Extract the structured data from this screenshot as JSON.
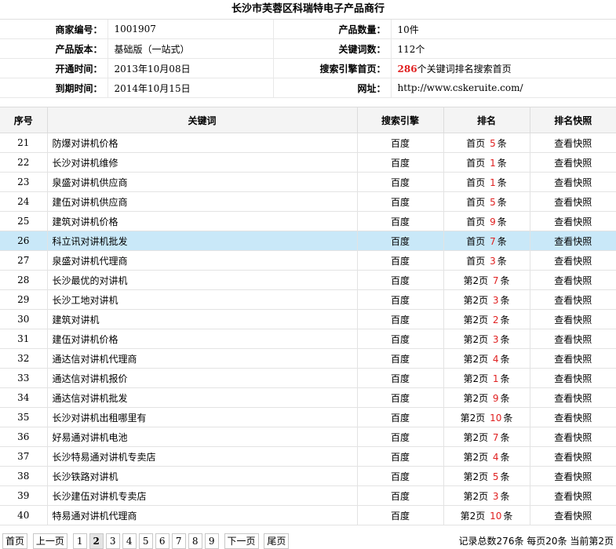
{
  "title": "长沙市芙蓉区科瑞特电子产品商行",
  "info": {
    "merchant_no_label": "商家编号：",
    "merchant_no": "1001907",
    "product_count_label": "产品数量：",
    "product_count": "10件",
    "version_label": "产品版本：",
    "version": "基础版（一站式）",
    "keyword_count_label": "关键词数：",
    "keyword_count": "112个",
    "open_label": "开通时间：",
    "open_time": "2013年10月08日",
    "se_home_label": "搜索引擎首页：",
    "se_home_num": "286",
    "se_home_text": "个关键词排名搜索首页",
    "expire_label": "到期时间：",
    "expire_time": "2014年10月15日",
    "site_label": "网址：",
    "site": "http://www.cskeruite.com/"
  },
  "table": {
    "headers": [
      "序号",
      "关键词",
      "搜索引擎",
      "排名",
      "排名快照"
    ],
    "rows": [
      {
        "no": "21",
        "keyword": "防爆对讲机价格",
        "engine": "百度",
        "page": "首页",
        "count": "5",
        "unit": "条",
        "snapshot": "查看快照"
      },
      {
        "no": "22",
        "keyword": "长沙对讲机维修",
        "engine": "百度",
        "page": "首页",
        "count": "1",
        "unit": "条",
        "snapshot": "查看快照"
      },
      {
        "no": "23",
        "keyword": "泉盛对讲机供应商",
        "engine": "百度",
        "page": "首页",
        "count": "1",
        "unit": "条",
        "snapshot": "查看快照"
      },
      {
        "no": "24",
        "keyword": "建伍对讲机供应商",
        "engine": "百度",
        "page": "首页",
        "count": "5",
        "unit": "条",
        "snapshot": "查看快照"
      },
      {
        "no": "25",
        "keyword": "建筑对讲机价格",
        "engine": "百度",
        "page": "首页",
        "count": "9",
        "unit": "条",
        "snapshot": "查看快照"
      },
      {
        "no": "26",
        "keyword": "科立讯对讲机批发",
        "engine": "百度",
        "page": "首页",
        "count": "7",
        "unit": "条",
        "snapshot": "查看快照"
      },
      {
        "no": "27",
        "keyword": "泉盛对讲机代理商",
        "engine": "百度",
        "page": "首页",
        "count": "3",
        "unit": "条",
        "snapshot": "查看快照"
      },
      {
        "no": "28",
        "keyword": "长沙最优的对讲机",
        "engine": "百度",
        "page": "第2页",
        "count": "7",
        "unit": "条",
        "snapshot": "查看快照"
      },
      {
        "no": "29",
        "keyword": "长沙工地对讲机",
        "engine": "百度",
        "page": "第2页",
        "count": "3",
        "unit": "条",
        "snapshot": "查看快照"
      },
      {
        "no": "30",
        "keyword": "建筑对讲机",
        "engine": "百度",
        "page": "第2页",
        "count": "2",
        "unit": "条",
        "snapshot": "查看快照"
      },
      {
        "no": "31",
        "keyword": "建伍对讲机价格",
        "engine": "百度",
        "page": "第2页",
        "count": "3",
        "unit": "条",
        "snapshot": "查看快照"
      },
      {
        "no": "32",
        "keyword": "通达信对讲机代理商",
        "engine": "百度",
        "page": "第2页",
        "count": "4",
        "unit": "条",
        "snapshot": "查看快照"
      },
      {
        "no": "33",
        "keyword": "通达信对讲机报价",
        "engine": "百度",
        "page": "第2页",
        "count": "1",
        "unit": "条",
        "snapshot": "查看快照"
      },
      {
        "no": "34",
        "keyword": "通达信对讲机批发",
        "engine": "百度",
        "page": "第2页",
        "count": "9",
        "unit": "条",
        "snapshot": "查看快照"
      },
      {
        "no": "35",
        "keyword": "长沙对讲机出租哪里有",
        "engine": "百度",
        "page": "第2页",
        "count": "10",
        "unit": "条",
        "snapshot": "查看快照"
      },
      {
        "no": "36",
        "keyword": "好易通对讲机电池",
        "engine": "百度",
        "page": "第2页",
        "count": "7",
        "unit": "条",
        "snapshot": "查看快照"
      },
      {
        "no": "37",
        "keyword": "长沙特易通对讲机专卖店",
        "engine": "百度",
        "page": "第2页",
        "count": "4",
        "unit": "条",
        "snapshot": "查看快照"
      },
      {
        "no": "38",
        "keyword": "长沙铁路对讲机",
        "engine": "百度",
        "page": "第2页",
        "count": "5",
        "unit": "条",
        "snapshot": "查看快照"
      },
      {
        "no": "39",
        "keyword": "长沙建伍对讲机专卖店",
        "engine": "百度",
        "page": "第2页",
        "count": "3",
        "unit": "条",
        "snapshot": "查看快照"
      },
      {
        "no": "40",
        "keyword": "特易通对讲机代理商",
        "engine": "百度",
        "page": "第2页",
        "count": "10",
        "unit": "条",
        "snapshot": "查看快照"
      }
    ]
  },
  "pager": {
    "first": "首页",
    "prev": "上一页",
    "pages": [
      "1",
      "2",
      "3",
      "4",
      "5",
      "6",
      "7",
      "8",
      "9"
    ],
    "current_page": "2",
    "next": "下一页",
    "last": "尾页",
    "summary": "记录总数276条 每页20条 当前第2页"
  },
  "colors": {
    "highlight_row": "#c9e8f8",
    "count_red": "#e02020"
  }
}
